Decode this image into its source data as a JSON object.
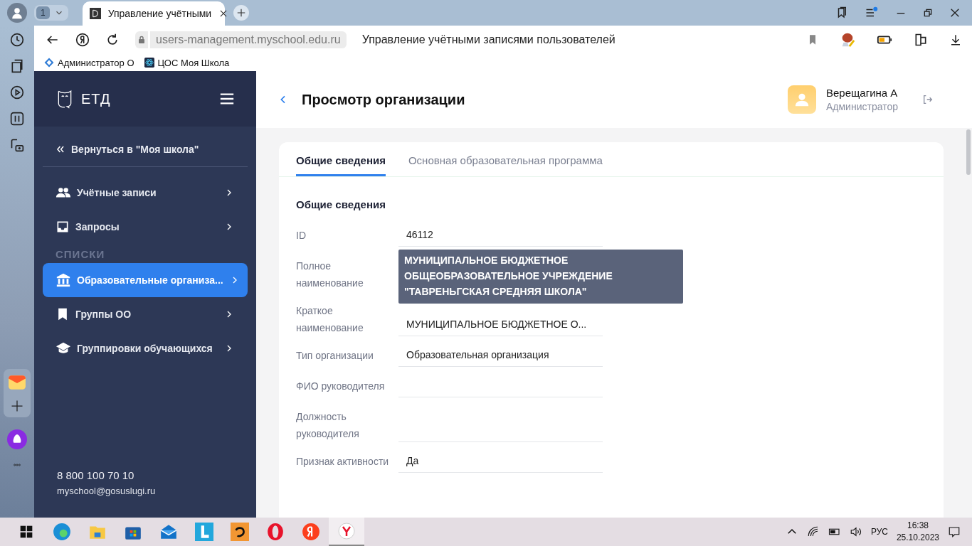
{
  "browser": {
    "tab_count": "1",
    "tab_title": "Управление учётными",
    "address": "users-management.myschool.edu.ru",
    "page_title": "Управление учётными записями пользователей",
    "bookmarks": [
      "Администратор О",
      "ЦОС Моя Школа"
    ]
  },
  "sidebar": {
    "logo": "ЕТД",
    "back_link": "Вернуться в \"Моя школа\"",
    "items": [
      {
        "label": "Учётные записи",
        "selected": false
      },
      {
        "label": "Запросы",
        "selected": false
      }
    ],
    "section_title": "СПИСКИ",
    "list_items": [
      {
        "label": "Образовательные организа...",
        "selected": true
      },
      {
        "label": "Группы ОО",
        "selected": false
      },
      {
        "label": "Группировки обучающихся",
        "selected": false
      }
    ],
    "phone": "8 800 100 70 10",
    "email": "myschool@gosuslugi.ru"
  },
  "header": {
    "title": "Просмотр организации",
    "user_name": "Верещагина А",
    "user_role": "Администратор"
  },
  "tabs": [
    {
      "label": "Общие сведения",
      "selected": true
    },
    {
      "label": "Основная образовательная программа",
      "selected": false
    }
  ],
  "section_title": "Общие сведения",
  "fields": [
    {
      "label": "ID",
      "value": "46112"
    },
    {
      "label": "Полное наименование",
      "tooltip": "МУНИЦИПАЛЬНОЕ БЮДЖЕТНОЕ ОБЩЕОБРАЗОВАТЕЛЬНОЕ УЧРЕЖДЕНИЕ \"ТАВРЕНЬГСКАЯ СРЕДНЯЯ ШКОЛА\""
    },
    {
      "label": "Краткое наименование",
      "value": "МУНИЦИПАЛЬНОЕ БЮДЖЕТНОЕ О..."
    },
    {
      "label": "Тип организации",
      "value": "Образовательная организация"
    },
    {
      "label": "ФИО руководителя"
    },
    {
      "label": "Должность руководителя"
    },
    {
      "label": "Признак активности",
      "value": "Да"
    }
  ],
  "taskbar": {
    "language": "РУС",
    "time": "16:38",
    "date": "25.10.2023"
  }
}
